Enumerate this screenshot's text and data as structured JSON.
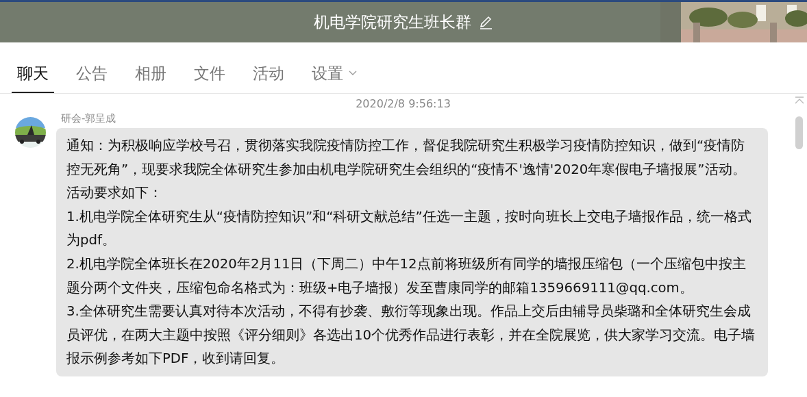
{
  "header": {
    "title": "机电学院研究生班长群"
  },
  "tabs": [
    {
      "label": "聊天",
      "selected": true,
      "dropdown": false
    },
    {
      "label": "公告",
      "selected": false,
      "dropdown": false
    },
    {
      "label": "相册",
      "selected": false,
      "dropdown": false
    },
    {
      "label": "文件",
      "selected": false,
      "dropdown": false
    },
    {
      "label": "活动",
      "selected": false,
      "dropdown": false
    },
    {
      "label": "设置",
      "selected": false,
      "dropdown": true
    }
  ],
  "chat": {
    "timestamp": "2020/2/8 9:56:13",
    "message": {
      "sender": "研会-郭呈成",
      "paragraphs": [
        "通知：为积极响应学校号召，贯彻落实我院疫情防控工作，督促我院研究生积极学习疫情防控知识，做到“疫情防控无死角”，现要求我院全体研究生参加由机电学院研究生会组织的“疫情不'逸情'2020年寒假电子墙报展”活动。活动要求如下：",
        "1.机电学院全体研究生从“疫情防控知识”和“科研文献总结”任选一主题，按时向班长上交电子墙报作品，统一格式为pdf。",
        "2.机电学院全体班长在2020年2月11日（下周二）中午12点前将班级所有同学的墙报压缩包（一个压缩包中按主题分两个文件夹，压缩包命名格式为：班级+电子墙报）发至曹康同学的邮箱1359669111@qq.com。",
        "3.全体研究生需要认真对待本次活动，不得有抄袭、敷衍等现象出现。作品上交后由辅导员柴璐和全体研究生会成员评优，在两大主题中按照《评分细则》各选出10个优秀作品进行表彰，并在全院展览，供大家学习交流。电子墙报示例参考如下PDF，收到请回复。"
      ]
    }
  }
}
